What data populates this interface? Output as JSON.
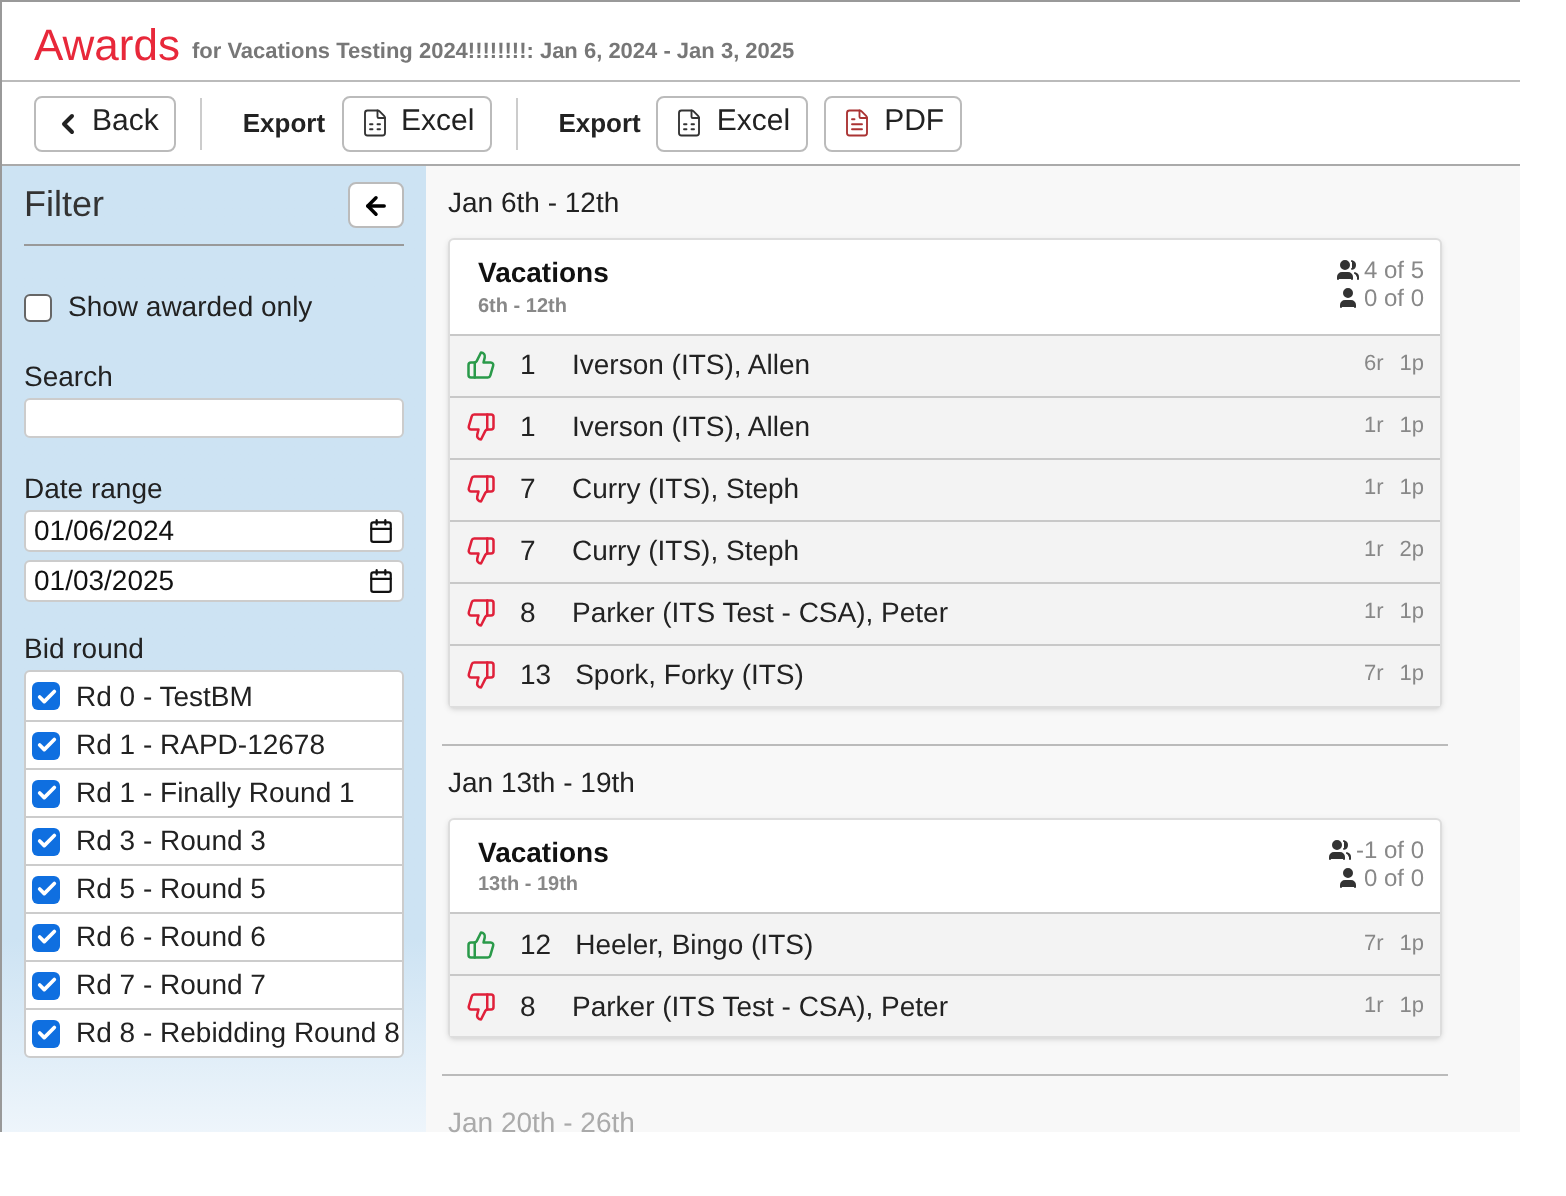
{
  "header": {
    "title": "Awards",
    "subtitle": "for Vacations Testing 2024!!!!!!!!: Jan 6, 2024 - Jan 3, 2025"
  },
  "toolbar": {
    "back": "Back",
    "exports": [
      {
        "label": "Export",
        "buttons": [
          {
            "kind": "excel",
            "label": "Excel"
          }
        ]
      },
      {
        "label": "Export",
        "buttons": [
          {
            "kind": "excel",
            "label": "Excel"
          },
          {
            "kind": "pdf",
            "label": "PDF"
          }
        ]
      }
    ]
  },
  "filter": {
    "title": "Filter",
    "show_awarded_only": {
      "label": "Show awarded only",
      "checked": false
    },
    "search": {
      "label": "Search"
    },
    "date_range": {
      "label": "Date range",
      "from": "01/06/2024",
      "to": "01/03/2025"
    },
    "bid_round": {
      "label": "Bid round",
      "items": [
        {
          "label": "Rd 0 - TestBM",
          "checked": true
        },
        {
          "label": "Rd 1 - RAPD-12678",
          "checked": true
        },
        {
          "label": "Rd 1 - Finally Round 1",
          "checked": true
        },
        {
          "label": "Rd 3 - Round 3",
          "checked": true
        },
        {
          "label": "Rd 5 - Round 5",
          "checked": true
        },
        {
          "label": "Rd 6 - Round 6",
          "checked": true
        },
        {
          "label": "Rd 7 - Round 7",
          "checked": true
        },
        {
          "label": "Rd 8 - Rebidding Round 8",
          "checked": true
        }
      ]
    }
  },
  "weeks": [
    {
      "heading": "Jan 6th - 12th",
      "faded": false,
      "cards": [
        {
          "title": "Vacations",
          "dates": "6th - 12th",
          "group_count": "4 of 5",
          "person_count": "0 of 0",
          "rows": [
            {
              "awarded": true,
              "number": "1",
              "name": "Iverson (ITS), Allen",
              "r": "6r",
              "p": "1p"
            },
            {
              "awarded": false,
              "number": "1",
              "name": "Iverson (ITS), Allen",
              "r": "1r",
              "p": "1p"
            },
            {
              "awarded": false,
              "number": "7",
              "name": "Curry (ITS), Steph",
              "r": "1r",
              "p": "1p"
            },
            {
              "awarded": false,
              "number": "7",
              "name": "Curry (ITS), Steph",
              "r": "1r",
              "p": "2p"
            },
            {
              "awarded": false,
              "number": "8",
              "name": "Parker (ITS Test - CSA), Peter",
              "r": "1r",
              "p": "1p"
            },
            {
              "awarded": false,
              "number": "13",
              "name": "Spork, Forky (ITS)",
              "r": "7r",
              "p": "1p"
            }
          ]
        }
      ]
    },
    {
      "heading": "Jan 13th - 19th",
      "faded": false,
      "cards": [
        {
          "title": "Vacations",
          "dates": "13th - 19th",
          "group_count": "-1 of 0",
          "person_count": "0 of 0",
          "rows": [
            {
              "awarded": true,
              "number": "12",
              "name": "Heeler, Bingo (ITS)",
              "r": "7r",
              "p": "1p"
            },
            {
              "awarded": false,
              "number": "8",
              "name": "Parker (ITS Test - CSA), Peter",
              "r": "1r",
              "p": "1p"
            }
          ]
        }
      ]
    },
    {
      "heading": "Jan 20th - 26th",
      "faded": true
    }
  ]
}
